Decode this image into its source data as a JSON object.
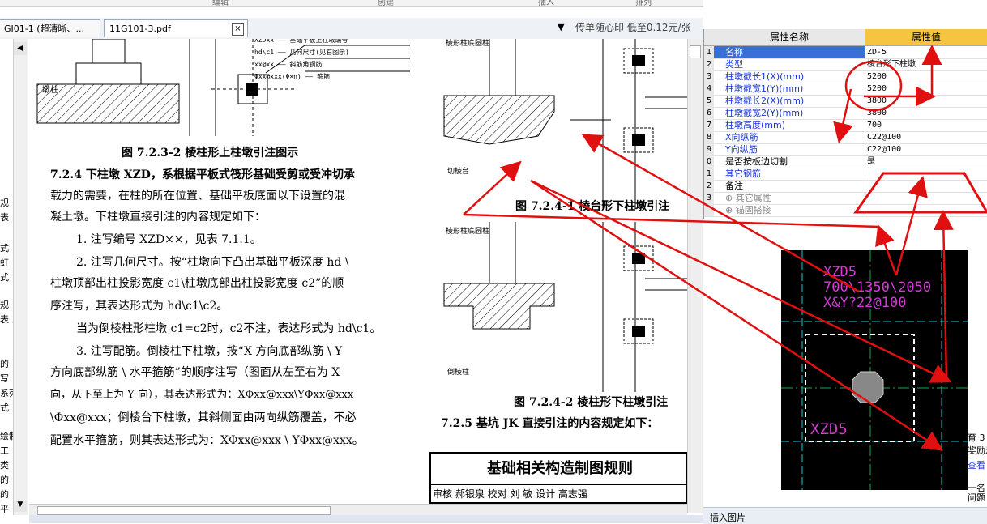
{
  "top_strip": {
    "labels": [
      "编辑",
      "创建",
      "插入",
      "插入",
      "排列"
    ]
  },
  "tabs": [
    {
      "label": "GI01-1 (超清晰、..."
    },
    {
      "label": "11G101-3.pdf",
      "close": "×"
    }
  ],
  "ad_text": "传单随心印 低至0.12元/张",
  "dropdown": "▼",
  "left_pane": {
    "arrow": "◀",
    "scroll_down": "▼",
    "snippets": [
      "规",
      "表",
      "式",
      "虹",
      "式",
      "规",
      "表",
      "的",
      "写",
      "系列",
      "式",
      "绘制",
      "工",
      "类",
      "的",
      "的",
      "平"
    ]
  },
  "document": {
    "caption_top": "图 7.2.3-2  棱柱形上柱墩引注图示",
    "para1_line1": "7.2.4  下柱墩 XZD，系根据平板式筏形基础受剪或受冲切承",
    "para1_line2": "载力的需要，在柱的所在位置、基础平板底面以下设置的混",
    "para1_line3": "凝土墩。下柱墩直接引注的内容规定如下：",
    "item1": "1. 注写编号 XZD××，见表 7.1.1。",
    "item2_line1": "2. 注写几何尺寸。按“柱墩向下凸出基础平板深度 hd \\",
    "item2_line2": "柱墩顶部出柱投影宽度 c1\\柱墩底部出柱投影宽度 c2”的顺",
    "item2_line3": "序注写，其表达形式为 hd\\c1\\c2。",
    "item2_line4": "当为倒棱柱形柱墩 c1=c2时，c2不注，表达形式为 hd\\c1。",
    "item3_line1": "3. 注写配筋。倒棱柱下柱墩，按“X 方向底部纵筋 \\ Y",
    "item3_line2": "方向底部纵筋 \\ 水平箍筋”的顺序注写（图面从左至右为 X",
    "item3_line3": "向，从下至上为 Y 向），其表达形式为：XΦxx@xxx\\YΦxx@xxx",
    "item3_line4": "\\Φxx@xxx；倒棱台下柱墩，其斜侧面由两向纵筋覆盖，不必",
    "item3_line5": "配置水平箍筋，则其表达形式为：XΦxx@xxx \\ YΦxx@xxx。",
    "fig1_caption": "图 7.2.4-1  棱台形下柱墩引注",
    "fig2_caption": "图 7.2.4-2  棱柱形下柱墩引注",
    "section_255": "7.2.5  基坑 JK 直接引注的内容规定如下：",
    "fig_label_1": "棱形柱底圆柱",
    "fig_label_2": "切棱台",
    "fig_label_3": "棱形柱底圆柱",
    "fig_label_4": "倒棱柱",
    "legend_lines": [
      "XZDxx —— 基础平板上柱墩编号",
      "hd\\c1 —— 几何尺寸(见右图示)",
      "xx@xx —— 斜筋角钢筋",
      "Φxx@xxx(Φ×n) —— 箍筋"
    ],
    "fig_upper_labels": [
      "墩柱"
    ],
    "title_block": {
      "title": "基础相关构造制图规则",
      "row": "审核 郝银泉  校对 刘 敏  设计 高志强"
    }
  },
  "property_grid": {
    "header_name": "属性名称",
    "header_value": "属性值",
    "rows": [
      {
        "num": "1",
        "name": "名称",
        "value": "ZD-5",
        "style": "blue"
      },
      {
        "num": "2",
        "name": "类型",
        "value": "棱台形下柱墩",
        "style": "blue"
      },
      {
        "num": "3",
        "name": "柱墩截长1(X)(mm)",
        "value": "5200",
        "style": "blue"
      },
      {
        "num": "4",
        "name": "柱墩截宽1(Y)(mm)",
        "value": "5200",
        "style": "blue"
      },
      {
        "num": "5",
        "name": "柱墩截长2(X)(mm)",
        "value": "3800",
        "style": "blue"
      },
      {
        "num": "6",
        "name": "柱墩截宽2(Y)(mm)",
        "value": "3800",
        "style": "blue"
      },
      {
        "num": "7",
        "name": "柱墩高度(mm)",
        "value": "700",
        "style": "blue"
      },
      {
        "num": "8",
        "name": "X向纵筋",
        "value": "C22@100",
        "style": "blue"
      },
      {
        "num": "9",
        "name": "Y向纵筋",
        "value": "C22@100",
        "style": "blue"
      },
      {
        "num": "0",
        "name": "是否按板边切割",
        "value": "是",
        "style": "black"
      },
      {
        "num": "1",
        "name": "其它钢筋",
        "value": "",
        "style": "blue"
      },
      {
        "num": "2",
        "name": "备注",
        "value": "",
        "style": "black"
      },
      {
        "num": "3",
        "name": "⊕ 其它属性",
        "value": "",
        "style": "gray"
      },
      {
        "num": "",
        "name": "⊕ 锚固搭接",
        "value": "",
        "style": "gray"
      }
    ]
  },
  "cad": {
    "text_lines": [
      "XZD5",
      "700\\1350\\2050",
      "X&Y?22@100"
    ],
    "label": "XZD5"
  },
  "right_snippets": [
    "育 3",
    "奖励示",
    "查看",
    "一名",
    "问题"
  ],
  "bottom_bar": {
    "insert_label": "插入图片"
  },
  "colors": {
    "annotation_red": "#e01010",
    "cad_magenta": "#d43bd4",
    "header_gold": "#f5c542",
    "link_blue": "#1a35d6"
  }
}
